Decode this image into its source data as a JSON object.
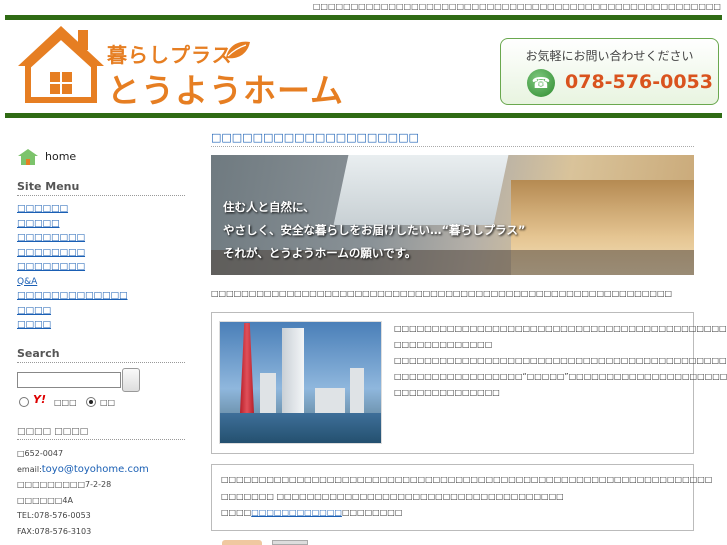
{
  "header": {
    "top_text": "□□□□□□□□□□□□□□□□□□□□□□□□□□□□□□□□□□□□□□□□□□□□□□□□□□□□□□",
    "logo_sub": "暮らしプラス",
    "logo_main": "とうようホーム",
    "contact_label": "お気軽にお問い合わせください",
    "phone": "078-576-0053"
  },
  "sidebar": {
    "home_label": "home",
    "site_menu_title": "Site Menu",
    "menu_items": [
      {
        "label": "□□□□□□"
      },
      {
        "label": "□□□□□"
      },
      {
        "label": "□□□□□□□□"
      },
      {
        "label": "□□□□□□□□"
      },
      {
        "label": "□□□□□□□□"
      },
      {
        "label": "Q&A"
      },
      {
        "label": "□□□□□□□□□□□□□"
      },
      {
        "label": "□□□□"
      },
      {
        "label": "□□□□"
      }
    ],
    "search_title": "Search",
    "search_value": "",
    "search_engine_label": "□□□",
    "search_site_label": "□□",
    "company_title": "□□□□ □□□□",
    "postal": "□652-0047",
    "email_prefix": "email:",
    "email": "toyo@toyohome.com",
    "address1": "□□□□□□□□□7-2-28",
    "address2": "□□□□□□4A",
    "tel": "TEL:078-576-0053",
    "fax": "FAX:078-576-3103"
  },
  "main": {
    "title": "□□□□□□□□□□□□□□□□□□□□",
    "hero_lines": [
      "住む人と自然に、",
      "やさしく、安全な暮らしをお届けしたい…“暮らしプラス”",
      "それが、とうようホームの願いです。"
    ],
    "intro": "□□□□□□□□□□□□□□□□□□□□□□□□□□□□□□□□□□□□□□□□□□□□□□□□□□□□□□□□□□□□□",
    "box1_lines": [
      "□□□□□□□□□□□□□□□□□□□□□□□□□□□□□□□□□□□□□□□□□□□□□□□□□□□□□□□",
      "□□□□□□□□□□□□□",
      "□□□□□□□□□□□□□□□□□□□□□□□□□□□□□□□□□□□□□□□□□□□□□□□□□□□□□□□",
      "□□□□□□□□□□□□□□□□□“□□□□□”□□□□□□□□□□□□□□□□□□□□□□□□□□□□□□",
      "□□□□□□□□□□□□□□"
    ],
    "box2_line1": "□□□□□□□□□□□□□□□□□□□□□□□□□□□□□□□□□□□□□□□□□□□□□□□□□□□□□□□□□□□□□□□□□",
    "box2_line2": "□□□□□□□ □□□□□□□□□□□□□□□□□□□□□□□□□□□□□□□□□□□□□□",
    "box2_line3_prefix": "□□□□",
    "box2_line3_link": "□□□□□□□□□□□□",
    "box2_line3_suffix": "□□□□□□□□"
  }
}
